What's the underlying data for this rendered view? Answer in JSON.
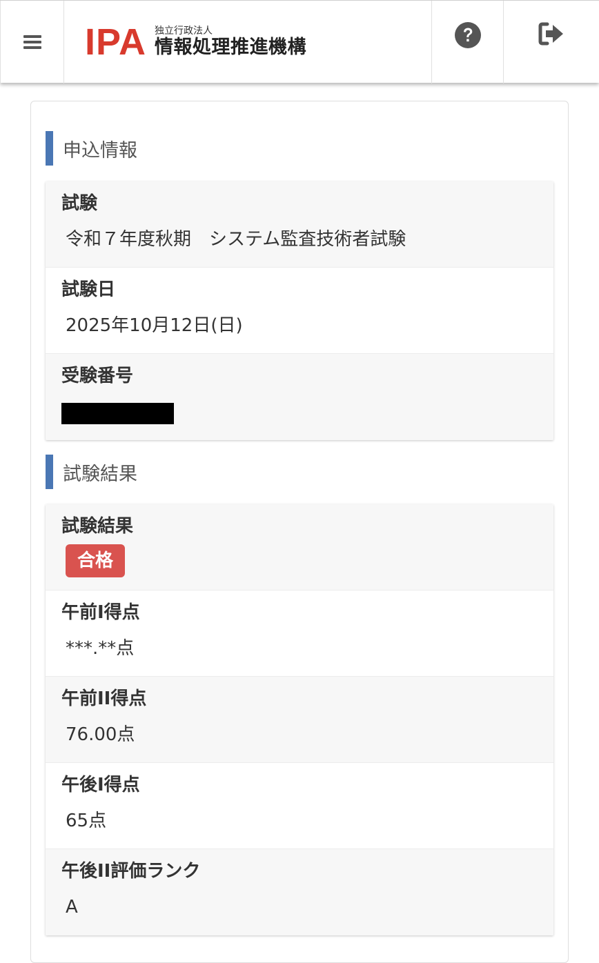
{
  "header": {
    "menu_icon": "hamburger-menu-icon",
    "logo_mark": "IPA",
    "logo_sub": "独立行政法人",
    "logo_main": "情報処理推進機構",
    "help_icon": "question-circle-icon",
    "logout_icon": "sign-out-icon"
  },
  "application": {
    "heading": "申込情報",
    "rows": [
      {
        "label": "試験",
        "value": "令和７年度秋期　システム監査技術者試験"
      },
      {
        "label": "試験日",
        "value": "2025年10月12日(日)"
      },
      {
        "label": "受験番号",
        "value": ""
      }
    ]
  },
  "results": {
    "heading": "試験結果",
    "result_label": "試験結果",
    "result_badge": "合格",
    "rows": [
      {
        "label": "午前I得点",
        "value": "***.**点"
      },
      {
        "label": "午前II得点",
        "value": "76.00点"
      },
      {
        "label": "午後I得点",
        "value": "65点"
      },
      {
        "label": "午後II評価ランク",
        "value": "A"
      }
    ]
  },
  "colors": {
    "accent_bar": "#4a77b4",
    "pass_badge": "#d9534f",
    "logo_red": "#d83a2d"
  }
}
